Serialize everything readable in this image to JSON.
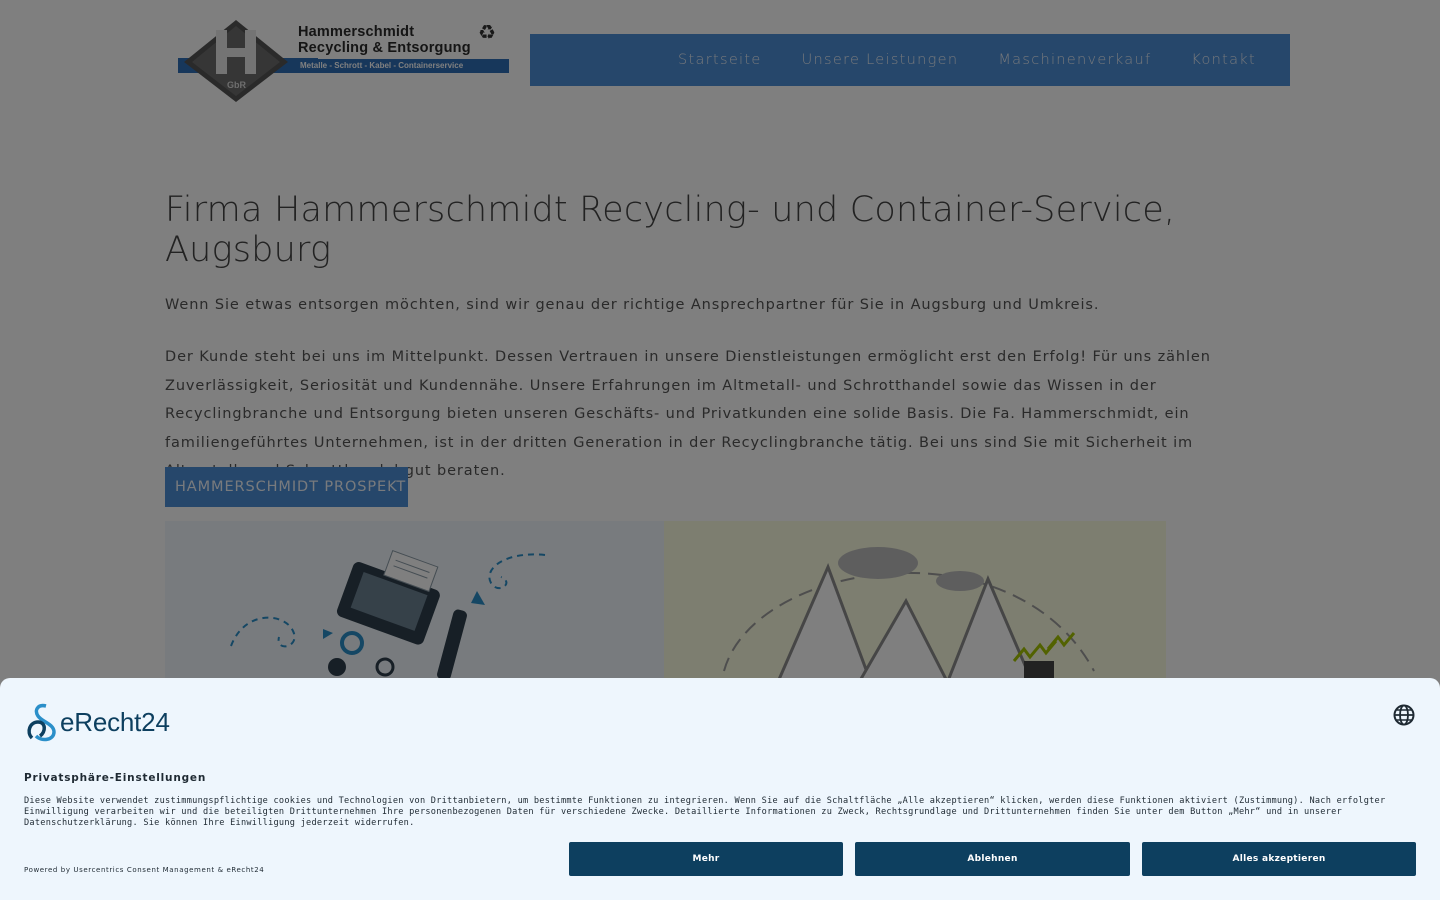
{
  "logo": {
    "line1": "Hammerschmidt",
    "line2": "Recycling & Entsorgung",
    "band": "Metalle - Schrott - Kabel - Containerservice",
    "letter": "H",
    "tag": "GbR"
  },
  "nav": {
    "items": [
      "Startseite",
      "Unsere Leistungen",
      "Maschinenverkauf",
      "Kontakt"
    ]
  },
  "main": {
    "title": "Firma Hammerschmidt Recycling- und Container-Service, Augsburg",
    "intro": "Wenn Sie etwas entsorgen möchten, sind wir genau der richtige Ansprechpartner für Sie in Augsburg und Umkreis.",
    "body": "Der Kunde steht bei uns im Mittelpunkt. Dessen Vertrauen in unsere Dienstleistungen ermöglicht erst den Erfolg! Für uns zählen Zuverlässigkeit, Seriosität und Kundennähe. Unsere Erfahrungen im Altmetall- und Schrotthandel sowie das Wissen in der Recyclingbranche und Entsorgung bieten unseren Geschäfts- und Privatkunden eine solide Basis. Die Fa. Hammerschmidt, ein familiengeführtes Unternehmen, ist in der dritten Generation in der Recyclingbranche tätig. Bei uns sind Sie mit Sicherheit im Altmetall- und Schrotthandel gut beraten.",
    "button": "HAMMERSCHMIDT PROSPEKT"
  },
  "consent": {
    "brand": "eRecht24",
    "title": "Privatsphäre-Einstellungen",
    "text": "Diese Website verwendet zustimmungspflichtige cookies und Technologien von Drittanbietern, um bestimmte Funktionen zu integrieren. Wenn Sie auf die Schaltfläche „Alle akzeptieren“ klicken, werden diese Funktionen aktiviert (Zustimmung). Nach erfolgter Einwilligung verarbeiten wir und die beteiligten Drittunternehmen Ihre personenbezogenen Daten für verschiedene Zwecke. Detaillierte Informationen zu Zweck, Rechtsgrundlage und Drittunternehmen finden Sie unter dem Button „Mehr“ und in unserer Datenschutzerklärung. Sie können Ihre Einwilligung jederzeit widerrufen.",
    "powered": "Powered by Usercentrics Consent Management & eRecht24",
    "buttons": {
      "more": "Mehr",
      "deny": "Ablehnen",
      "accept": "Alles akzeptieren"
    }
  },
  "colors": {
    "nav_bg": "#4d8fd6",
    "consent_bg": "#eef6fd",
    "consent_button": "#0d3f5f"
  },
  "icons": {
    "language": "globe-icon",
    "recycle": "recycle-icon"
  }
}
